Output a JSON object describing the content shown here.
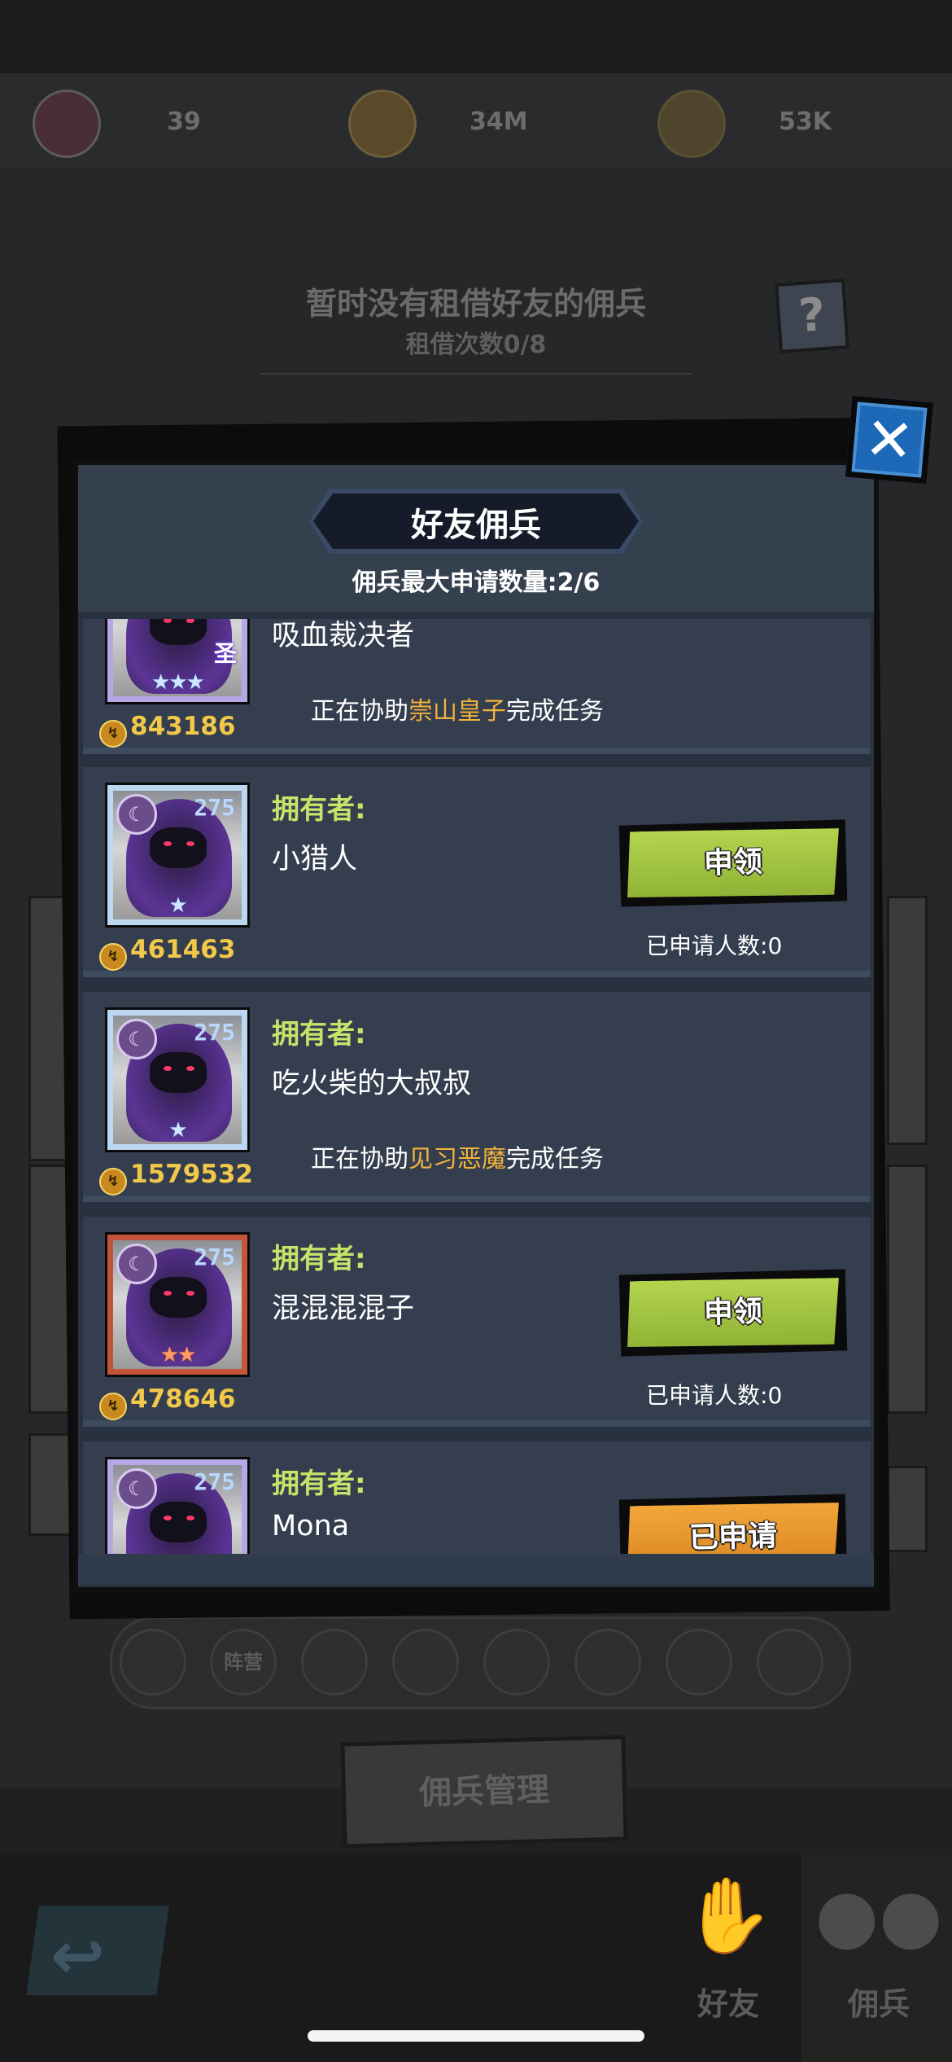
{
  "resources": [
    {
      "icon": "heart-icon",
      "value": "39"
    },
    {
      "icon": "swirl-icon",
      "value": "34M"
    },
    {
      "icon": "power-icon",
      "value": "53K"
    }
  ],
  "notice": {
    "title": "暂时没有租借好友的佣兵",
    "subtitle": "租借次数0/8",
    "help_icon": "?"
  },
  "filters": {
    "camp_label": "阵营"
  },
  "manage_button": "佣兵管理",
  "nav": {
    "back_icon": "↩",
    "friends_label": "好友",
    "mercenary_label": "佣兵"
  },
  "modal": {
    "close_icon": "✕",
    "title": "好友佣兵",
    "subtitle": "佣兵最大申请数量:2/6",
    "owner_label": "拥有者:",
    "apply_label": "申领",
    "applied_label": "已申请",
    "assist_prefix": "正在协助",
    "assist_suffix": "完成任务",
    "applicants_prefix": "已申请人数:",
    "entries": [
      {
        "name": "吸血裁决者",
        "power": "843186",
        "assisting": "崇山皇子",
        "badge": "圣",
        "stars": "★★★"
      },
      {
        "level": "275",
        "power": "461463",
        "owner": "小猎人",
        "applicants": "0",
        "stars": "★"
      },
      {
        "level": "275",
        "power": "1579532",
        "owner": "吃火柴的大叔叔",
        "assisting": "见习恶魔",
        "stars": "★"
      },
      {
        "level": "275",
        "power": "478646",
        "owner": "混混混混子",
        "applicants": "0",
        "stars": "★★"
      },
      {
        "level": "275",
        "owner": "Mona"
      }
    ]
  },
  "colors": {
    "owner_label": "#c7e36a",
    "highlight": "#f2b23c",
    "apply_button": "#a6c842",
    "applied_button": "#e99a30",
    "modal_bg": "#27313f"
  }
}
